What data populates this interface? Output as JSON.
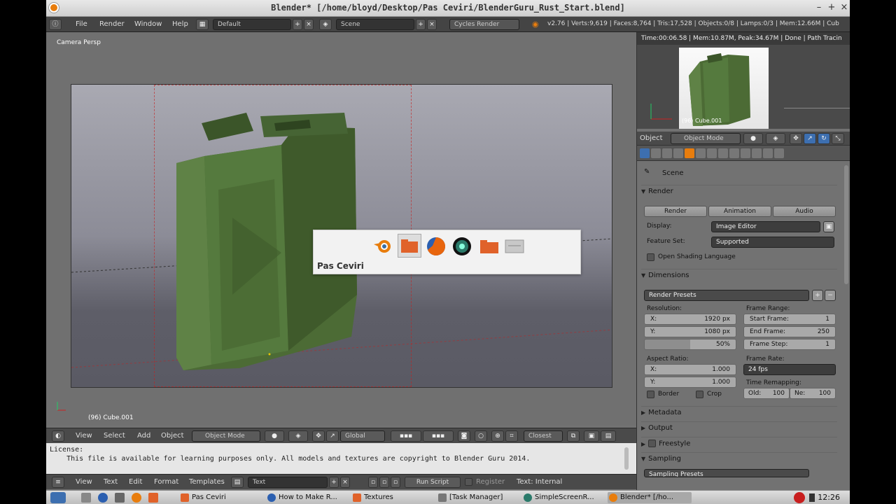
{
  "window": {
    "title": "Blender* [/home/bloyd/Desktop/Pas Ceviri/BlenderGuru_Rust_Start.blend]",
    "minimize": "–",
    "maximize": "+",
    "close": "×"
  },
  "info_header": {
    "menus": [
      "File",
      "Render",
      "Window",
      "Help"
    ],
    "screen_layout": "Default",
    "scene": "Scene",
    "engine": "Cycles Render",
    "stats": "v2.76 | Verts:9,619 | Faces:8,764 | Tris:17,528 | Objects:0/8 | Lamps:0/3 | Mem:12.66M | Cub"
  },
  "viewport": {
    "view_label": "Camera Persp",
    "object_label": "(96) Cube.001"
  },
  "app_switcher": {
    "selected_label": "Pas Ceviri"
  },
  "view3d_header": {
    "menus": [
      "View",
      "Select",
      "Add",
      "Object"
    ],
    "mode": "Object Mode",
    "orientation": "Global",
    "snap_target": "Closest"
  },
  "text_editor": {
    "lines": [
      "License:",
      "    This file is available for learning purposes only. All models and textures are copyright to Blender Guru 2014."
    ],
    "header_menus": [
      "View",
      "Text",
      "Edit",
      "Format",
      "Templates"
    ],
    "datablock": "Text",
    "run_script": "Run Script",
    "register": "Register",
    "status": "Text: Internal"
  },
  "render_view": {
    "info": "Time:00:06.58 | Mem:10.87M, Peak:34.67M | Done | Path Tracin",
    "thumb_label": "(96) Cube.001"
  },
  "properties": {
    "header_label": "Object",
    "mode": "Object Mode",
    "scene_label": "Scene",
    "render_panel": {
      "title": "Render",
      "buttons": [
        "Render",
        "Animation",
        "Audio"
      ],
      "display_label": "Display:",
      "display_value": "Image Editor",
      "feature_label": "Feature Set:",
      "feature_value": "Supported",
      "osl_label": "Open Shading Language"
    },
    "dimensions_panel": {
      "title": "Dimensions",
      "presets": "Render Presets",
      "resolution_label": "Resolution:",
      "res_x_label": "X:",
      "res_x": "1920 px",
      "res_y_label": "Y:",
      "res_y": "1080 px",
      "res_pct": "50%",
      "frame_range_label": "Frame Range:",
      "start_label": "Start Frame:",
      "start": "1",
      "end_label": "End Frame:",
      "end": "250",
      "step_label": "Frame Step:",
      "step": "1",
      "aspect_label": "Aspect Ratio:",
      "asp_x_label": "X:",
      "asp_x": "1.000",
      "asp_y_label": "Y:",
      "asp_y": "1.000",
      "frame_rate_label": "Frame Rate:",
      "fps": "24 fps",
      "time_remap_label": "Time Remapping:",
      "old_label": "Old:",
      "old": "100",
      "new_label": "Ne:",
      "new": "100",
      "border_label": "Border",
      "crop_label": "Crop"
    },
    "collapsed_panels": [
      "Metadata",
      "Output",
      "Freestyle"
    ],
    "sampling_title": "Sampling",
    "sampling_presets": "Sampling Presets"
  },
  "taskbar": {
    "tasks": [
      "Pas Ceviri",
      "How to Make R...",
      "Textures",
      "[Task Manager]",
      "SimpleScreenR...",
      "Blender* [/ho..."
    ],
    "clock": "12:26"
  },
  "colors": {
    "accent": "#e87d0d",
    "safe_guide": "#c81e1e"
  }
}
